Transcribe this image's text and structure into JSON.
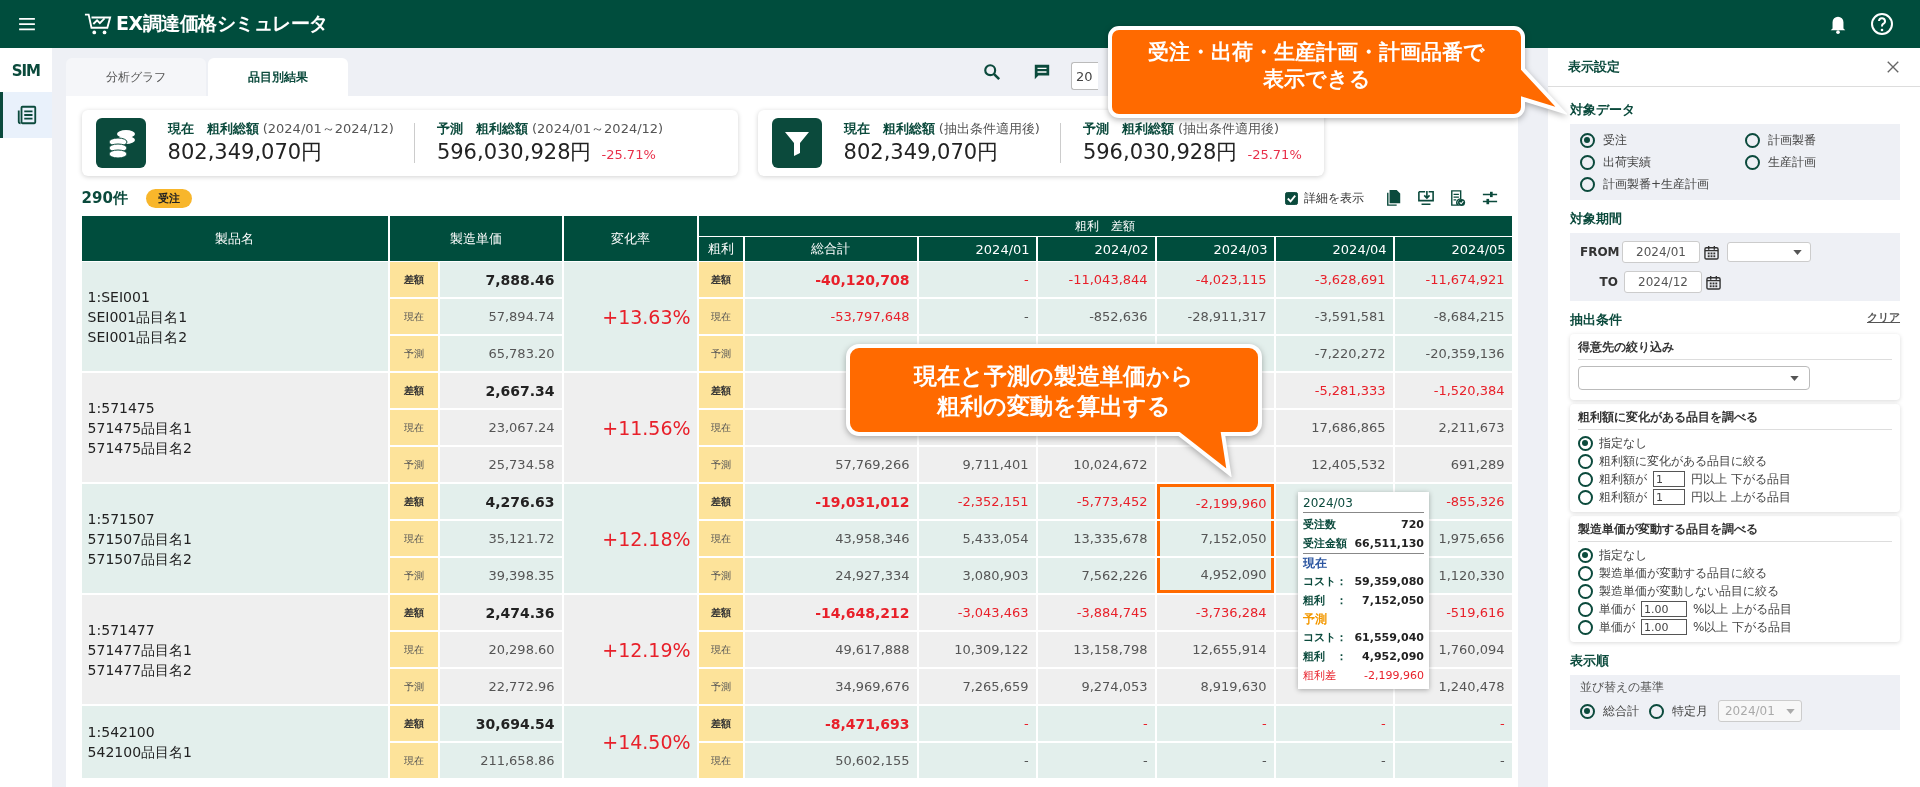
{
  "app": {
    "title": "EX調達価格シミュレータ"
  },
  "rail": {
    "brand": "SIM",
    "items": [
      {
        "selected": true
      }
    ]
  },
  "tabs": [
    {
      "label": "分析グラフ",
      "selected": false
    },
    {
      "label": "品目別結果",
      "selected": true
    }
  ],
  "toolbar": {
    "date_value": "20"
  },
  "summary_cards": [
    {
      "kind": "coins",
      "metrics": [
        {
          "label": "**現在　粗利総額** (2024/01～2024/12)",
          "value": "802,349,070円"
        },
        {
          "label": "**予測　粗利総額** (2024/01～2024/12)",
          "value": "596,030,928円",
          "change": "-25.71%"
        }
      ]
    },
    {
      "kind": "filter",
      "metrics": [
        {
          "label": "**現在　粗利総額** (抽出条件適用後)",
          "value": "802,349,070円"
        },
        {
          "label": "**予測　粗利総額** (抽出条件適用後)",
          "value": "596,030,928円",
          "change": "-25.71%"
        }
      ]
    }
  ],
  "count": "290件",
  "badge": "受注",
  "detail_toggle": {
    "label": "詳細を表示",
    "checked": true
  },
  "table": {
    "columns": [
      "製品名",
      "製造単価",
      "変化率"
    ],
    "group_header": "粗利　差額",
    "profit_label": "粗利",
    "total_label": "総合計",
    "months": [
      {
        "label": "2024/01",
        "highlighted": false
      },
      {
        "label": "2024/02",
        "highlighted": false
      },
      {
        "label": "2024/03",
        "highlighted": true
      },
      {
        "label": "2024/04",
        "highlighted": false
      },
      {
        "label": "2024/05",
        "highlighted": false
      }
    ],
    "rows": [
      {
        "name_lines": [
          "1:SEI001",
          "SEI001品目名1",
          "SEI001品目名2"
        ],
        "rate": "+13.63%",
        "highlighted": false,
        "subrows": [
          {
            "kind": "diff",
            "unit_label": "差額",
            "profit_label": "差額",
            "unit_price": "7,888.46",
            "cells": {
              "total": "-40,120,708",
              "month_1": "-",
              "month_2": "-11,043,844",
              "month_3": "-4,023,115",
              "month_4": "-3,628,691",
              "month_5": "-11,674,921"
            }
          },
          {
            "kind": "current",
            "unit_label": "現在",
            "profit_label": "現在",
            "unit_price": "57,894.74",
            "total_alert": true,
            "cells": {
              "total": "-53,797,648",
              "month_1": "-",
              "month_2": "-852,636",
              "month_3": "-28,911,317",
              "month_4": "-3,591,581",
              "month_5": "-8,684,215"
            }
          },
          {
            "kind": "forecast",
            "unit_label": "予測",
            "profit_label": "予測",
            "unit_price": "65,783.20",
            "cells": {
              "month_4": "-7,220,272",
              "month_5": "-20,359,136"
            }
          }
        ]
      },
      {
        "name_lines": [
          "1:571475",
          "571475品目名1",
          "571475品目名2"
        ],
        "rate": "+11.56%",
        "highlighted": false,
        "subrows": [
          {
            "kind": "diff",
            "unit_label": "差額",
            "profit_label": "差額",
            "unit_price": "2,667.34",
            "cells": {
              "month_4": "-5,281,333",
              "month_5": "-1,520,384"
            }
          },
          {
            "kind": "current",
            "unit_label": "現在",
            "profit_label": "現在",
            "unit_price": "23,067.24",
            "cells": {
              "month_4": "17,686,865",
              "month_5": "2,211,673"
            }
          },
          {
            "kind": "forecast",
            "unit_label": "予測",
            "profit_label": "予測",
            "unit_price": "25,734.58",
            "cells": {
              "total": "57,769,266",
              "month_1": "9,711,401",
              "month_2": "10,024,672",
              "month_4": "12,405,532",
              "month_5": "691,289"
            }
          }
        ]
      },
      {
        "name_lines": [
          "1:571507",
          "571507品目名1",
          "571507品目名2"
        ],
        "rate": "+12.18%",
        "highlighted": true,
        "subrows": [
          {
            "kind": "diff",
            "unit_label": "差額",
            "profit_label": "差額",
            "unit_price": "4,276.63",
            "cells": {
              "total": "-19,031,012",
              "month_1": "-2,352,151",
              "month_2": "-5,773,452",
              "month_3": "-2,199,960",
              "month_5": "-855,326"
            }
          },
          {
            "kind": "current",
            "unit_label": "現在",
            "profit_label": "現在",
            "unit_price": "35,121.72",
            "cells": {
              "total": "43,958,346",
              "month_1": "5,433,054",
              "month_2": "13,335,678",
              "month_3": "7,152,050",
              "month_5": "1,975,656"
            }
          },
          {
            "kind": "forecast",
            "unit_label": "予測",
            "profit_label": "予測",
            "unit_price": "39,398.35",
            "cells": {
              "total": "24,927,334",
              "month_1": "3,080,903",
              "month_2": "7,562,226",
              "month_3": "4,952,090",
              "month_5": "1,120,330"
            }
          }
        ]
      },
      {
        "name_lines": [
          "1:571477",
          "571477品目名1",
          "571477品目名2"
        ],
        "rate": "+12.19%",
        "highlighted": false,
        "subrows": [
          {
            "kind": "diff",
            "unit_label": "差額",
            "profit_label": "差額",
            "unit_price": "2,474.36",
            "cells": {
              "total": "-14,648,212",
              "month_1": "-3,043,463",
              "month_2": "-3,884,745",
              "month_3": "-3,736,284",
              "month_5": "-519,616"
            }
          },
          {
            "kind": "current",
            "unit_label": "現在",
            "profit_label": "現在",
            "unit_price": "20,298.60",
            "cells": {
              "total": "49,617,888",
              "month_1": "10,309,122",
              "month_2": "13,158,798",
              "month_3": "12,655,914",
              "month_5": "1,760,094"
            }
          },
          {
            "kind": "forecast",
            "unit_label": "予測",
            "profit_label": "予測",
            "unit_price": "22,772.96",
            "cells": {
              "total": "34,969,676",
              "month_1": "7,265,659",
              "month_2": "9,274,053",
              "month_3": "8,919,630",
              "month_5": "1,240,478"
            }
          }
        ]
      },
      {
        "name_lines": [
          "1:542100",
          "542100品目名1"
        ],
        "rate": "+14.50%",
        "highlighted": false,
        "subrows": [
          {
            "kind": "diff",
            "unit_label": "差額",
            "profit_label": "差額",
            "unit_price": "30,694.54",
            "cells": {
              "total": "-8,471,693",
              "month_1": "-",
              "month_2": "-",
              "month_3": "-",
              "month_4": "-",
              "month_5": "-"
            }
          },
          {
            "kind": "current",
            "unit_label": "現在",
            "profit_label": "現在",
            "unit_price": "211,658.86",
            "cells": {
              "total": "50,602,155",
              "month_1": "-",
              "month_2": "-",
              "month_3": "-",
              "month_4": "-",
              "month_5": "-"
            }
          }
        ]
      }
    ]
  },
  "tooltip": {
    "title": "2024/03",
    "rows": [
      {
        "kind": "pair",
        "label": "受注数",
        "value": "720"
      },
      {
        "kind": "pair",
        "label": "受注金額",
        "value": "66,511,130"
      },
      {
        "kind": "section",
        "label": "現在",
        "color": "#2b55a0"
      },
      {
        "kind": "pair",
        "label": "コスト：",
        "value": "59,359,080"
      },
      {
        "kind": "pair",
        "label": "粗利　：",
        "value": "7,152,050"
      },
      {
        "kind": "section",
        "label": "予測",
        "color": "#f39800"
      },
      {
        "kind": "pair",
        "label": "コスト：",
        "value": "61,559,040"
      },
      {
        "kind": "pair",
        "label": "粗利　：",
        "value": "4,952,090"
      },
      {
        "kind": "alert",
        "label": "粗利差",
        "value": "-2,199,960"
      }
    ]
  },
  "settings_panel": {
    "title": "表示設定",
    "target_data": {
      "heading": "対象データ",
      "options": [
        {
          "label": "受注",
          "selected": true
        },
        {
          "label": "計画製番",
          "selected": false
        },
        {
          "label": "出荷実績",
          "selected": false
        },
        {
          "label": "生産計画",
          "selected": false
        },
        {
          "label": "計画製番+生産計画",
          "selected": false
        }
      ]
    },
    "period": {
      "heading": "対象期間",
      "from_label": "FROM",
      "from_value": "2024/01",
      "to_label": "TO",
      "to_value": "2024/12"
    },
    "filters": {
      "heading": "抽出条件",
      "clear_link": "クリア",
      "customer_title": "得意先の絞り込み",
      "groups": [
        {
          "title": "粗利額に変化がある品目を調べる",
          "options": [
            {
              "kind": "plain",
              "label": "指定なし",
              "selected": true
            },
            {
              "kind": "plain",
              "label": "粗利額に変化がある品目に絞る",
              "selected": false
            },
            {
              "kind": "threshold",
              "prefix": "粗利額が",
              "value": "1",
              "suffix": "円以上 下がる品目",
              "selected": false
            },
            {
              "kind": "threshold",
              "prefix": "粗利額が",
              "value": "1",
              "suffix": "円以上 上がる品目",
              "selected": false
            }
          ]
        },
        {
          "title": "製造単価が変動する品目を調べる",
          "options": [
            {
              "kind": "plain",
              "label": "指定なし",
              "selected": true
            },
            {
              "kind": "plain",
              "label": "製造単価が変動する品目に絞る",
              "selected": false
            },
            {
              "kind": "plain",
              "label": "製造単価が変動しない品目に絞る",
              "selected": false
            },
            {
              "kind": "threshold",
              "prefix": "単価が",
              "value": "1.00",
              "suffix": "%以上 上がる品目",
              "selected": false
            },
            {
              "kind": "threshold",
              "prefix": "単価が",
              "value": "1.00",
              "suffix": "%以上 下がる品目",
              "selected": false
            }
          ]
        }
      ]
    },
    "sort": {
      "heading": "表示順",
      "subheading": "並び替えの基準",
      "options": [
        {
          "label": "総合計",
          "selected": true
        },
        {
          "label": "特定月",
          "selected": false
        }
      ],
      "month_value": "2024/01",
      "month_disabled": true
    }
  },
  "callouts": [
    {
      "lines": [
        "受注・出荷・生産計画・計画品番で",
        "表示できる"
      ]
    },
    {
      "lines": [
        "現在と予測の製造単価から",
        "粗利の変動を算出する"
      ]
    }
  ]
}
